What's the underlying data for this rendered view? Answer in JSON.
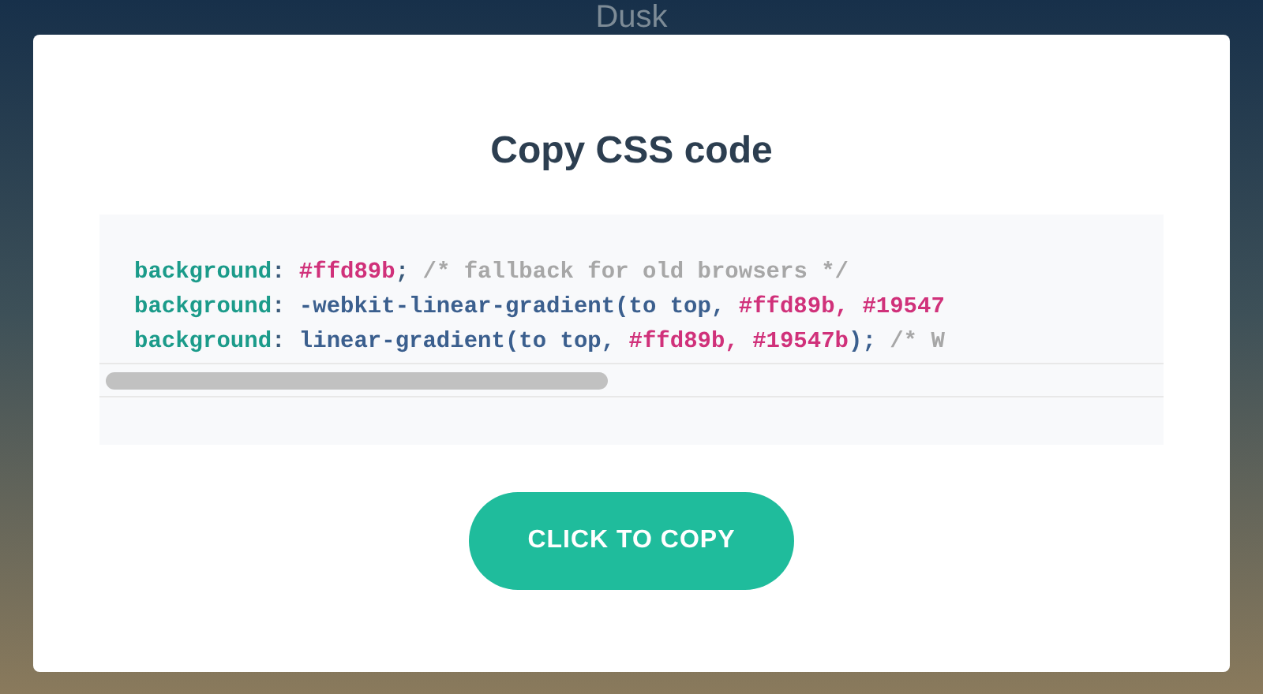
{
  "background_title": "Dusk",
  "modal": {
    "title": "Copy CSS code",
    "code_lines": [
      [
        {
          "kind": "prop",
          "text": "background"
        },
        {
          "kind": "punct",
          "text": ": "
        },
        {
          "kind": "hex",
          "text": "#ffd89b"
        },
        {
          "kind": "punct",
          "text": "; "
        },
        {
          "kind": "comment",
          "text": "/* fallback for old browsers */"
        }
      ],
      [
        {
          "kind": "prop",
          "text": "background"
        },
        {
          "kind": "punct",
          "text": ": "
        },
        {
          "kind": "func",
          "text": "-webkit-linear-gradient(to top, "
        },
        {
          "kind": "hex",
          "text": "#ffd89b, #19547"
        }
      ],
      [
        {
          "kind": "prop",
          "text": "background"
        },
        {
          "kind": "punct",
          "text": ": "
        },
        {
          "kind": "func",
          "text": "linear-gradient(to top, "
        },
        {
          "kind": "hex",
          "text": "#ffd89b, #19547b"
        },
        {
          "kind": "func",
          "text": "); "
        },
        {
          "kind": "comment",
          "text": "/* W"
        }
      ]
    ],
    "copy_button": "CLICK TO COPY"
  }
}
